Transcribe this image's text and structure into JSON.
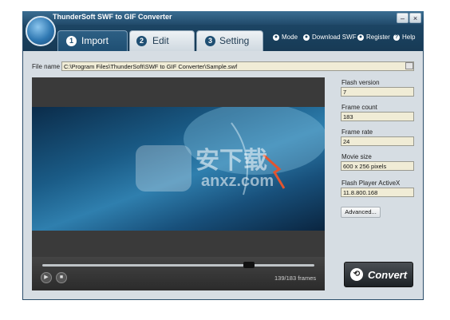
{
  "window": {
    "title": "ThunderSoft SWF to GIF Converter"
  },
  "tabs": [
    {
      "num": "1",
      "label": "Import"
    },
    {
      "num": "2",
      "label": "Edit"
    },
    {
      "num": "3",
      "label": "Setting"
    }
  ],
  "header_links": [
    {
      "icon": "mode-icon",
      "label": "Mode"
    },
    {
      "icon": "download-icon",
      "label": "Download SWF"
    },
    {
      "icon": "register-icon",
      "label": "Register"
    },
    {
      "icon": "help-icon",
      "label": "Help"
    }
  ],
  "file": {
    "label": "File name",
    "value": "C:\\Program Files\\ThunderSoft\\SWF to GIF Converter\\Sample.swf"
  },
  "info": [
    {
      "label": "Flash version",
      "value": "7"
    },
    {
      "label": "Frame count",
      "value": "183"
    },
    {
      "label": "Frame rate",
      "value": "24"
    },
    {
      "label": "Movie size",
      "value": "600 x 256 pixels"
    },
    {
      "label": "Flash Player ActiveX",
      "value": "11.8.800.168"
    }
  ],
  "advanced_label": "Advanced...",
  "player": {
    "frames": "139/183 frames",
    "progress": 0.76
  },
  "convert_label": "Convert",
  "watermark": {
    "cn": "安下载",
    "url": "anxz.com"
  }
}
